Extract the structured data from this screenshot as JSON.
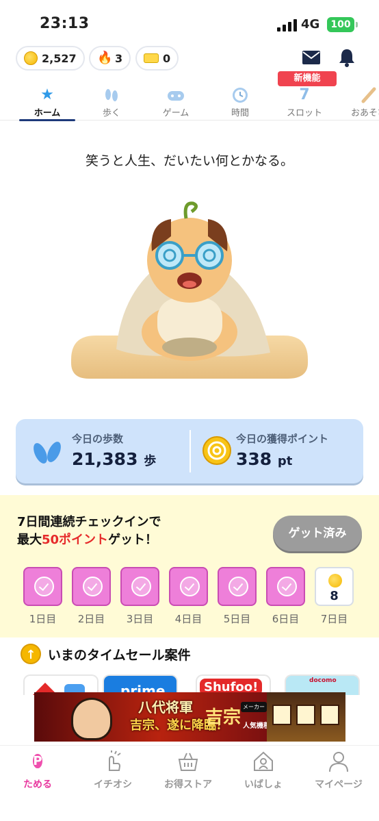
{
  "status_bar": {
    "time": "23:13",
    "network": "4G",
    "battery": "100"
  },
  "wallet": {
    "coins": "2,527",
    "streak": "3",
    "tickets": "0"
  },
  "new_badge": "新機能",
  "tabs": [
    {
      "label": "ホーム",
      "icon": "star-icon",
      "active": true
    },
    {
      "label": "歩く",
      "icon": "footprints-icon",
      "active": false
    },
    {
      "label": "ゲーム",
      "icon": "gamepad-icon",
      "active": false
    },
    {
      "label": "時間",
      "icon": "clock-icon",
      "active": false
    },
    {
      "label": "スロット",
      "icon": "slot-seven-icon",
      "active": false
    },
    {
      "label": "おあそび",
      "icon": "bat-icon",
      "active": false
    }
  ],
  "tagline": "笑うと人生、だいたい何とかなる。",
  "stats": {
    "steps_label": "今日の歩数",
    "steps_value": "21,383",
    "steps_unit": "歩",
    "points_label": "今日の獲得ポイント",
    "points_value": "338",
    "points_unit": "pt"
  },
  "checkin": {
    "title_line1": "7日間連続チェックインで",
    "title_line2_prefix": "最大",
    "title_line2_highlight": "50ポイント",
    "title_line2_suffix": "ゲット！",
    "button": "ゲット済み",
    "days": [
      {
        "label": "1日目",
        "done": true
      },
      {
        "label": "2日目",
        "done": true
      },
      {
        "label": "3日目",
        "done": true
      },
      {
        "label": "4日目",
        "done": true
      },
      {
        "label": "5日目",
        "done": true
      },
      {
        "label": "6日目",
        "done": true
      },
      {
        "label": "7日目",
        "done": false,
        "reward": "8"
      }
    ]
  },
  "sale": {
    "title": "いまのタイムセール案件",
    "cards": [
      "prime",
      "Shufoo!",
      "docomo"
    ]
  },
  "ad": {
    "line1": "八代将軍",
    "line2": "吉宗、遂に降臨!",
    "brand": "吉宗",
    "maker": "メーカー",
    "popular": "人気機種"
  },
  "bottom_nav": [
    {
      "label": "ためる",
      "icon": "p-point-icon",
      "active": true
    },
    {
      "label": "イチオシ",
      "icon": "finger-heart-icon",
      "active": false
    },
    {
      "label": "お得ストア",
      "icon": "basket-icon",
      "active": false
    },
    {
      "label": "いばしょ",
      "icon": "home-icon",
      "active": false
    },
    {
      "label": "マイページ",
      "icon": "person-icon",
      "active": false
    }
  ],
  "colors": {
    "accent_pink": "#e8399f",
    "navy": "#14203d",
    "card_blue": "#cfe3fb",
    "checkin_bg": "#fffbd6"
  }
}
